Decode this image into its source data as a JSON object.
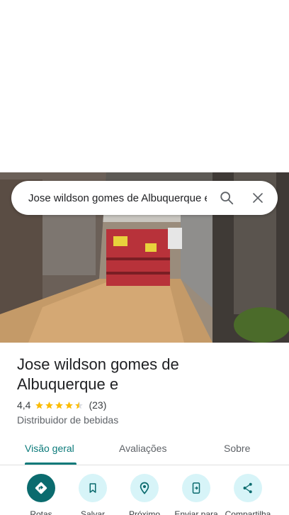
{
  "search": {
    "query": "Jose wildson gomes de Albuquerque e"
  },
  "place": {
    "name_line1": "Jose wildson gomes de",
    "name_line2": "Albuquerque e",
    "rating": "4,4",
    "stars_filled": 4.4,
    "review_count": "(23)",
    "category": "Distribuidor de bebidas"
  },
  "tabs": [
    {
      "label": "Visão geral",
      "active": true
    },
    {
      "label": "Avaliações",
      "active": false
    },
    {
      "label": "Sobre",
      "active": false
    }
  ],
  "actions": [
    {
      "label": "Rotas",
      "icon": "directions-icon"
    },
    {
      "label": "Salvar",
      "icon": "bookmark-icon"
    },
    {
      "label": "Próximo",
      "icon": "nearby-icon"
    },
    {
      "label": "Enviar para",
      "icon": "send-to-phone-icon"
    },
    {
      "label": "Compartilha",
      "icon": "share-icon"
    }
  ],
  "colors": {
    "accent": "#0b7a7a",
    "star": "#fbbc04",
    "action_bg": "#d7f4f8"
  }
}
